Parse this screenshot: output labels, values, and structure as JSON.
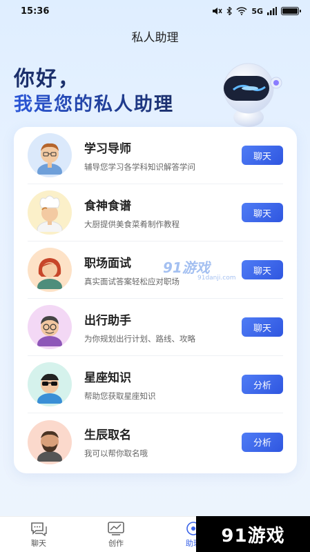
{
  "status_bar": {
    "time": "15:36",
    "network_label": "5G",
    "wifi_icon": "wifi-icon",
    "battery_icon": "battery-icon"
  },
  "page_title": "私人助理",
  "hero": {
    "line1": "你好，",
    "line2": "我是您的私人助理"
  },
  "assistants": [
    {
      "title": "学习导师",
      "desc": "辅导您学习各学科知识解答学问",
      "button": "聊天"
    },
    {
      "title": "食神食谱",
      "desc": "大厨提供美食菜肴制作教程",
      "button": "聊天"
    },
    {
      "title": "职场面试",
      "desc": "真实面试答案轻松应对职场",
      "button": "聊天"
    },
    {
      "title": "出行助手",
      "desc": "为你规划出行计划、路线、攻略",
      "button": "聊天"
    },
    {
      "title": "星座知识",
      "desc": "帮助您获取星座知识",
      "button": "分析"
    },
    {
      "title": "生辰取名",
      "desc": "我可以帮你取名哦",
      "button": "分析"
    }
  ],
  "tabs": [
    {
      "label": "聊天",
      "icon": "chat-icon"
    },
    {
      "label": "创作",
      "icon": "chart-icon"
    },
    {
      "label": "助理",
      "icon": "assistant-icon"
    }
  ],
  "watermark": {
    "main": "91游戏",
    "sub": "91danji.com"
  },
  "corner_logo": "91游戏",
  "colors": {
    "accent": "#3a63e8",
    "title_dark": "#1b2f6b"
  }
}
